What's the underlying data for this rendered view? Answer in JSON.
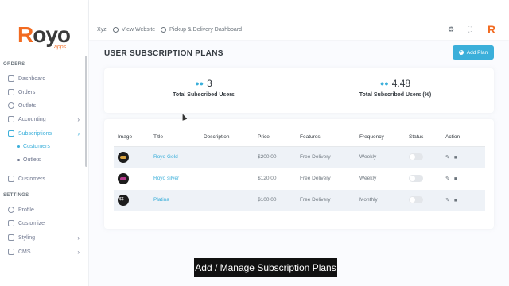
{
  "brand": {
    "logo_r": "R",
    "logo_rest": "oyo",
    "logo_sub": "apps",
    "topbar_mark": "R",
    "accent": "#3bafda",
    "brand_orange": "#f26b21"
  },
  "topbar": {
    "store": "Xyz",
    "view_website": "View Website",
    "dashboard_link": "Pickup & Delivery Dashboard",
    "icons": [
      "bell-icon",
      "fullscreen-icon"
    ]
  },
  "sidebar": {
    "section_orders": "ORDERS",
    "section_settings": "SETTINGS",
    "items": [
      {
        "label": "Dashboard"
      },
      {
        "label": "Orders"
      },
      {
        "label": "Outlets"
      },
      {
        "label": "Accounting",
        "chevron": "›"
      },
      {
        "label": "Subscriptions",
        "chevron": "›"
      },
      {
        "label": "Customers"
      },
      {
        "label": "Profile"
      },
      {
        "label": "Customize"
      },
      {
        "label": "Styling",
        "chevron": "›"
      },
      {
        "label": "CMS",
        "chevron": "›"
      }
    ],
    "sub_items": [
      {
        "label": "Customers"
      },
      {
        "label": "Outlets"
      }
    ]
  },
  "page": {
    "title": "USER SUBSCRIPTION PLANS",
    "add_button": "Add Plan"
  },
  "stats": [
    {
      "value": "3",
      "label": "Total Subscribed Users"
    },
    {
      "value": "4.48",
      "label": "Total Subscribed Users (%)"
    }
  ],
  "table": {
    "headers": [
      "Image",
      "Title",
      "Description",
      "Price",
      "Features",
      "Frequency",
      "Status",
      "Action"
    ],
    "rows": [
      {
        "title": "Royo Gold",
        "description": "",
        "price": "$200.00",
        "features": "Free Delivery",
        "frequency": "Weekly",
        "status_on": false
      },
      {
        "title": "Royo silver",
        "description": "",
        "price": "$120.00",
        "features": "Free Delivery",
        "frequency": "Weekly",
        "status_on": false
      },
      {
        "title": "Platina",
        "description": "",
        "price": "$100.00",
        "features": "Free Delivery",
        "frequency": "Monthly",
        "status_on": false
      }
    ]
  },
  "caption": "Add / Manage Subscription Plans"
}
